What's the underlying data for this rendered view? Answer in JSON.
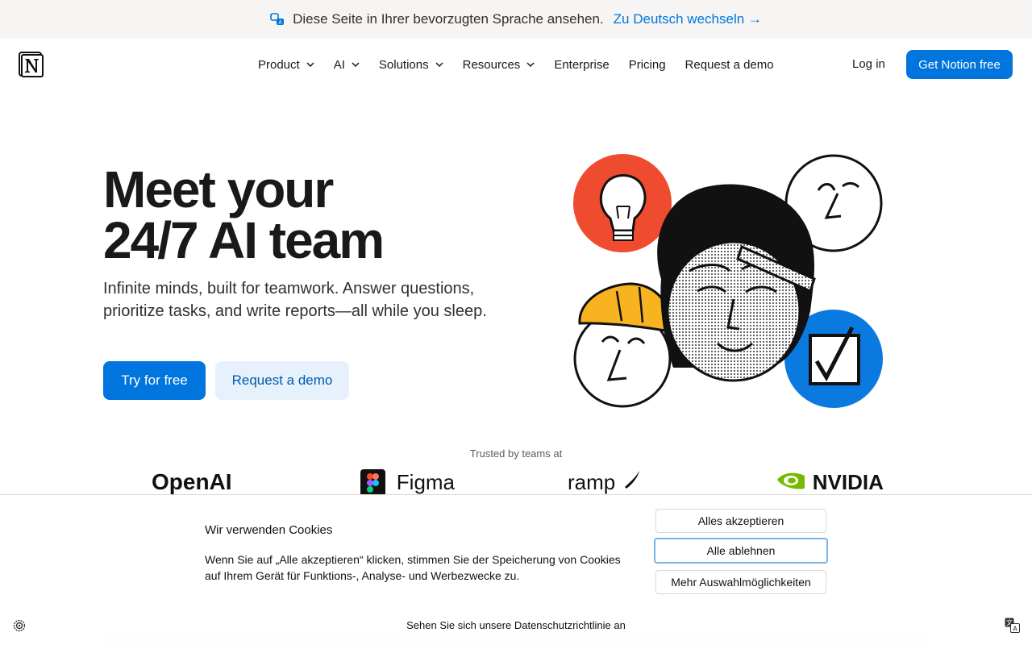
{
  "banner": {
    "message": "Diese Seite in Ihrer bevorzugten Sprache ansehen.",
    "link": "Zu Deutsch wechseln →"
  },
  "nav": {
    "items": [
      {
        "label": "Product"
      },
      {
        "label": "AI"
      },
      {
        "label": "Solutions"
      },
      {
        "label": "Resources"
      },
      {
        "label": "Enterprise"
      },
      {
        "label": "Pricing"
      },
      {
        "label": "Request a demo"
      }
    ],
    "login": "Log in",
    "cta": "Get Notion free"
  },
  "hero": {
    "title_line1": "Meet your",
    "title_line2": "24/7 AI team",
    "subtitle": "Infinite minds, built for teamwork. Answer questions, prioritize tasks, and write reports—all while you sleep.",
    "primary": "Try for free",
    "secondary": "Request a demo"
  },
  "trusted": {
    "label": "Trusted by teams at",
    "logos": [
      "OpenAI",
      "Figma",
      "ramp",
      "NVIDIA"
    ]
  },
  "cookie": {
    "title": "Wir verwenden Cookies",
    "text": "Wenn Sie auf „Alle akzeptieren“ klicken, stimmen Sie der Speicherung von Cookies auf Ihrem Gerät für Funktions-, Analyse- und Werbezwecke zu.",
    "accept": "Alles akzeptieren",
    "reject": "Alle ablehnen",
    "more": "Mehr Auswahlmöglichkeiten",
    "privacy": "Sehen Sie sich unsere Datenschutzrichtlinie an"
  },
  "colors": {
    "accent": "#0075de",
    "accent_light": "#e6f1fc",
    "illustration_red": "#ef4b2e",
    "illustration_blue": "#0b7ae0",
    "illustration_yellow": "#f7b320"
  }
}
